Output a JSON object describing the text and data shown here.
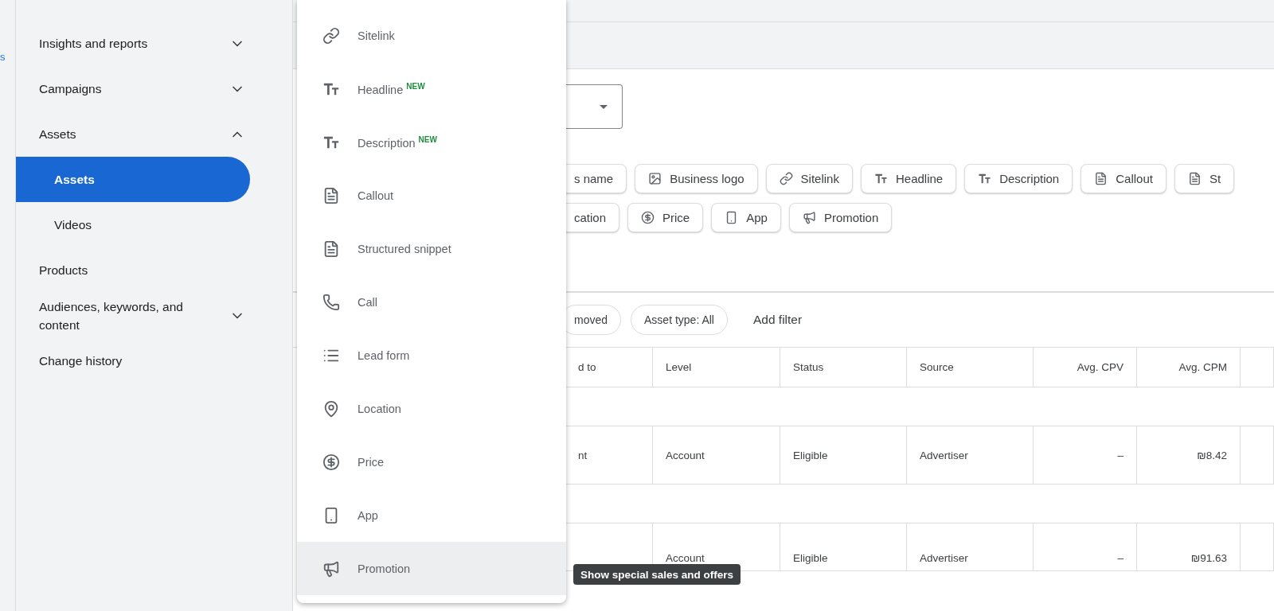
{
  "rail": {
    "link": "s"
  },
  "sidebar": {
    "items": [
      {
        "label": "Insights and reports",
        "expanded": false
      },
      {
        "label": "Campaigns",
        "expanded": false
      },
      {
        "label": "Assets",
        "expanded": true,
        "children": [
          {
            "label": "Assets",
            "selected": true
          },
          {
            "label": "Videos",
            "selected": false
          }
        ]
      },
      {
        "label": "Products"
      },
      {
        "label": "Audiences, keywords, and content",
        "expanded": false
      },
      {
        "label": "Change history"
      }
    ]
  },
  "menu": {
    "items": [
      {
        "kind": "sitelink",
        "label": "Sitelink",
        "hovered": false
      },
      {
        "kind": "headline",
        "label": "Headline",
        "badge": "NEW",
        "hovered": false
      },
      {
        "kind": "description",
        "label": "Description",
        "badge": "NEW",
        "hovered": false
      },
      {
        "kind": "callout",
        "label": "Callout",
        "hovered": false
      },
      {
        "kind": "snippet",
        "label": "Structured snippet",
        "hovered": false
      },
      {
        "kind": "call",
        "label": "Call",
        "hovered": false
      },
      {
        "kind": "lead_form",
        "label": "Lead form",
        "hovered": false
      },
      {
        "kind": "location",
        "label": "Location",
        "hovered": false
      },
      {
        "kind": "price",
        "label": "Price",
        "hovered": false
      },
      {
        "kind": "app",
        "label": "App",
        "hovered": false
      },
      {
        "kind": "promotion",
        "label": "Promotion",
        "hovered": true
      }
    ]
  },
  "tooltip": "Show special sales and offers",
  "asset_chips": [
    [
      {
        "kind": "text",
        "label": "s name"
      },
      {
        "kind": "logo",
        "label": "Business logo"
      },
      {
        "kind": "sitelink",
        "label": "Sitelink"
      },
      {
        "kind": "headline",
        "label": "Headline"
      },
      {
        "kind": "description",
        "label": "Description"
      },
      {
        "kind": "callout",
        "label": "Callout"
      },
      {
        "kind": "snippet",
        "label": "St"
      }
    ],
    [
      {
        "kind": "text",
        "label": "cation"
      },
      {
        "kind": "price",
        "label": "Price"
      },
      {
        "kind": "app",
        "label": "App"
      },
      {
        "kind": "promotion",
        "label": "Promotion"
      }
    ]
  ],
  "filters": {
    "chips": [
      "moved",
      "Asset type: All"
    ],
    "add": "Add filter"
  },
  "table": {
    "columns": [
      "d to",
      "Level",
      "Status",
      "Source",
      "Avg. CPV",
      "Avg. CPM"
    ],
    "rows": [
      {
        "cells": [
          "nt",
          "Account",
          "Eligible",
          "Advertiser",
          "–",
          "₪8.42"
        ]
      },
      {
        "cells": [
          "",
          "Account",
          "Eligible",
          "Advertiser",
          "–",
          "₪91.63"
        ]
      }
    ]
  }
}
